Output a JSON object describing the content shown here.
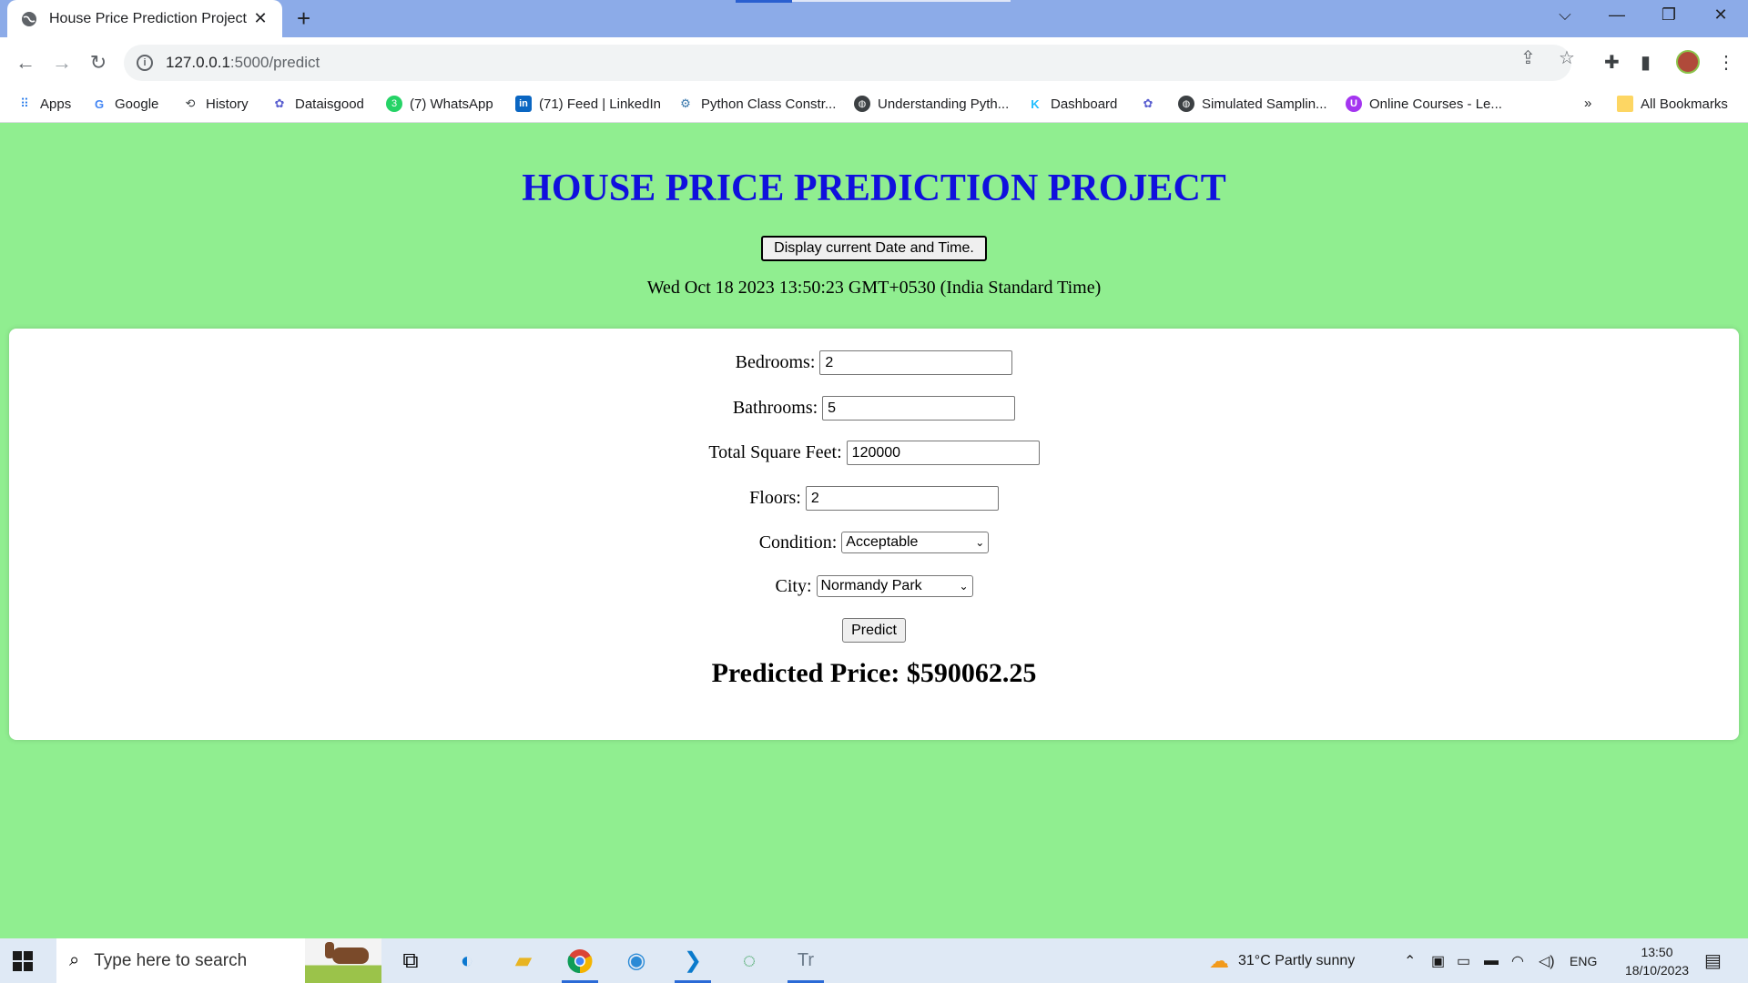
{
  "browser": {
    "tab_title": "House Price Prediction Project",
    "tab_close": "✕",
    "new_tab": "+",
    "url_host": "127.0.0.1",
    "url_path": ":5000/predict",
    "win_controls": {
      "tab_search": "⌵",
      "minimize": "—",
      "restore": "❐",
      "close": "✕"
    }
  },
  "bookmarks": {
    "items": [
      {
        "label": "Apps",
        "icon": "apps-grid-icon"
      },
      {
        "label": "Google",
        "icon": "google-icon"
      },
      {
        "label": "History",
        "icon": "history-icon"
      },
      {
        "label": "Dataisgood",
        "icon": "openai-icon"
      },
      {
        "label": "(7) WhatsApp",
        "icon": "whatsapp-icon"
      },
      {
        "label": "(71) Feed | LinkedIn",
        "icon": "linkedin-icon"
      },
      {
        "label": "Python Class Constr...",
        "icon": "python-icon"
      },
      {
        "label": "Understanding Pyth...",
        "icon": "globe-icon"
      },
      {
        "label": "Dashboard",
        "icon": "kaggle-icon"
      },
      {
        "label": "",
        "icon": "openai-icon"
      },
      {
        "label": "Simulated Samplin...",
        "icon": "globe-icon"
      },
      {
        "label": "Online Courses - Le...",
        "icon": "udemy-icon"
      }
    ],
    "overflow": "»",
    "all_bookmarks": "All Bookmarks"
  },
  "page": {
    "heading": "HOUSE PRICE PREDICTION PROJECT",
    "datetime_button": "Display current Date and Time.",
    "datetime_text": "Wed Oct 18 2023 13:50:23 GMT+0530 (India Standard Time)",
    "form": {
      "bedrooms_label": "Bedrooms:",
      "bedrooms_value": "2",
      "bathrooms_label": "Bathrooms:",
      "bathrooms_value": "5",
      "sqft_label": "Total Square Feet:",
      "sqft_value": "120000",
      "floors_label": "Floors:",
      "floors_value": "2",
      "condition_label": "Condition:",
      "condition_value": "Acceptable",
      "city_label": "City:",
      "city_value": "Normandy Park",
      "predict_button": "Predict"
    },
    "result": "Predicted Price: $590062.25"
  },
  "taskbar": {
    "search_placeholder": "Type here to search",
    "weather": "31°C  Partly sunny",
    "language": "ENG",
    "time": "13:50",
    "date": "18/10/2023"
  },
  "colors": {
    "page_bg": "#90ee90",
    "heading": "#1010dd",
    "tabstrip": "#8cabe8"
  }
}
